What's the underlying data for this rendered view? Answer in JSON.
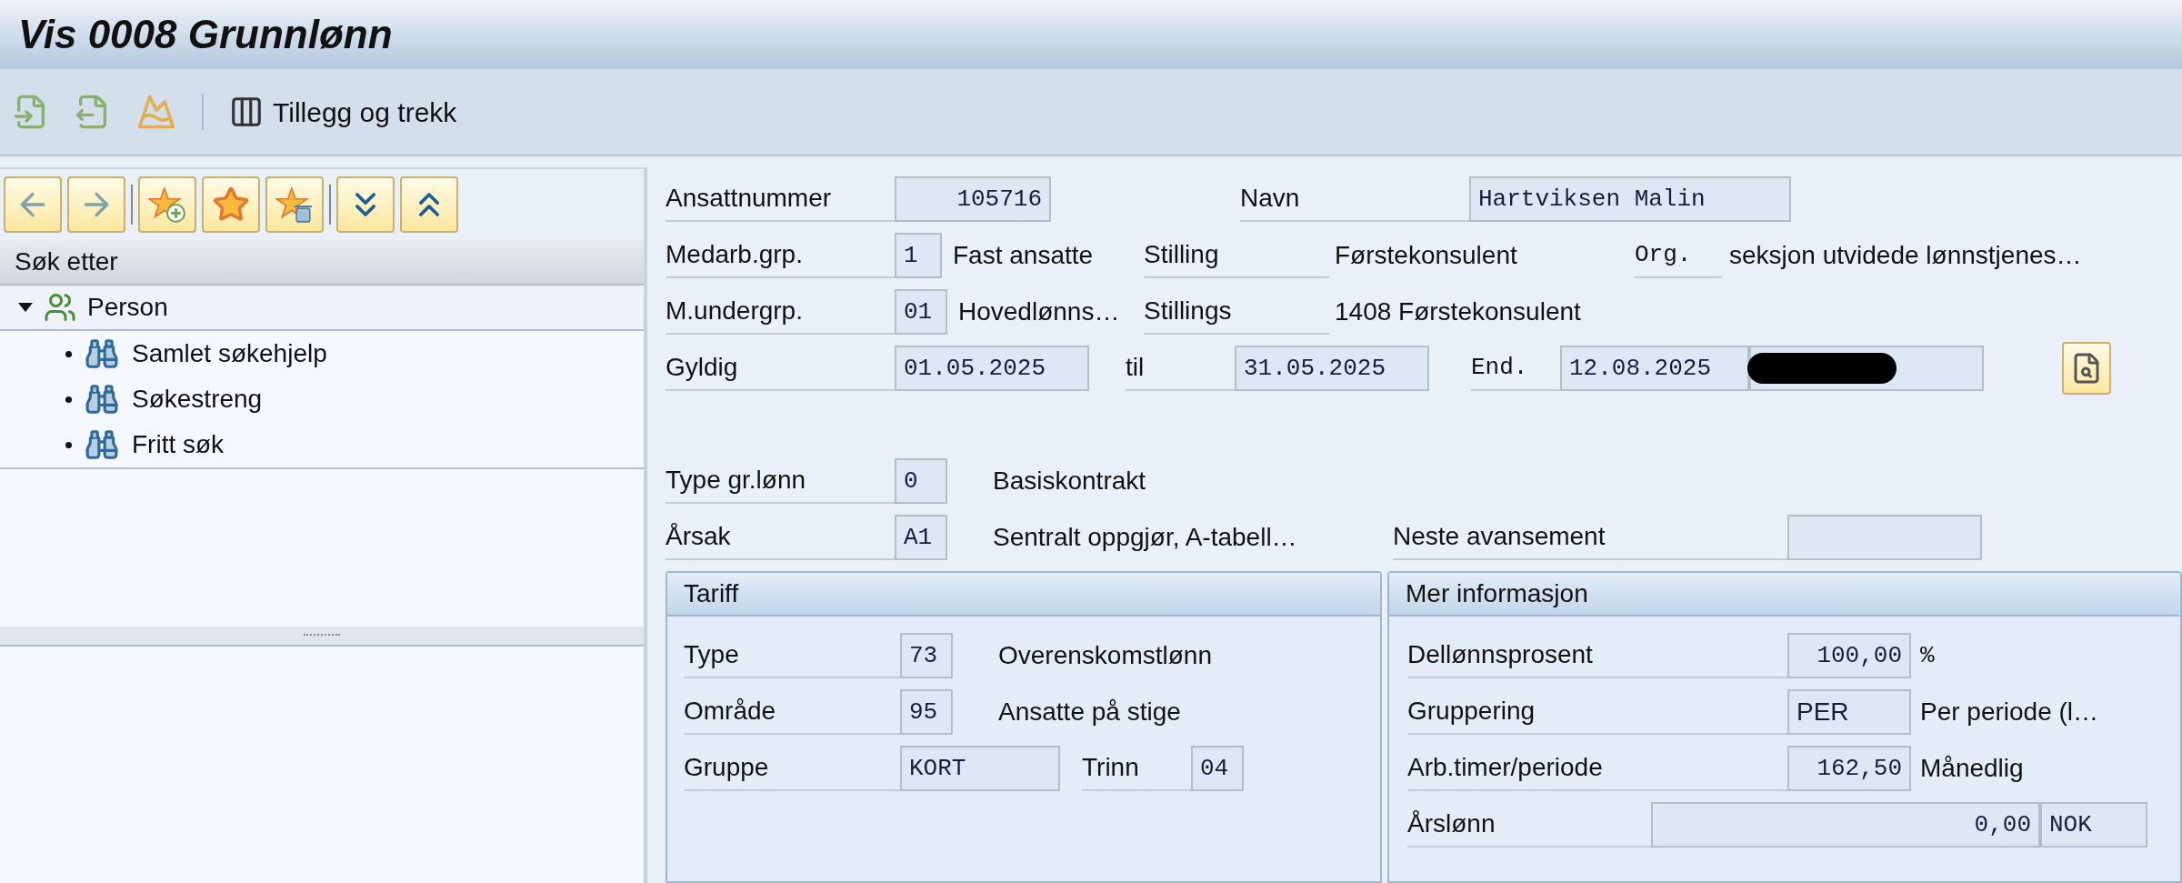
{
  "window": {
    "title": "Vis 0008 Grunnlønn"
  },
  "toolbar": {
    "button": "Tillegg og trekk"
  },
  "nav_panel": {
    "heading": "Søk etter",
    "tree": [
      {
        "label": "Person",
        "expanded": true,
        "children": [
          {
            "label": "Samlet søkehjelp"
          },
          {
            "label": "Søkestreng"
          },
          {
            "label": "Fritt søk"
          }
        ]
      }
    ]
  },
  "header": {
    "employee_number": {
      "label": "Ansattnummer",
      "value": "105716"
    },
    "name": {
      "label": "Navn",
      "value": "Hartviksen Malin"
    },
    "employee_group": {
      "label": "Medarb.grp.",
      "value": "1",
      "text": "Fast ansatte"
    },
    "position": {
      "label": "Stilling",
      "text": "Førstekonsulent"
    },
    "org": {
      "label": "Org.",
      "text": "seksjon utvidede lønnstjenes…"
    },
    "employee_subgroup": {
      "label": "M.undergrp.",
      "value": "01",
      "text": "Hovedlønns…"
    },
    "job": {
      "label": "Stillings",
      "text": "1408 Førstekonsulent"
    },
    "valid_from": {
      "label": "Gyldig",
      "value": "01.05.2025"
    },
    "valid_to": {
      "label": "til",
      "value": "31.05.2025"
    },
    "changed": {
      "label": "End.",
      "value": "12.08.2025"
    }
  },
  "basic_pay": {
    "pay_type": {
      "label": "Type gr.lønn",
      "value": "0",
      "text": "Basiskontrakt"
    },
    "reason": {
      "label": "Årsak",
      "value": "A1",
      "text": "Sentralt oppgjør, A-tabell…"
    },
    "next_promotion": {
      "label": "Neste avansement"
    }
  },
  "tariff": {
    "title": "Tariff",
    "type": {
      "label": "Type",
      "value": "73",
      "text": "Overenskomstlønn"
    },
    "area": {
      "label": "Område",
      "value": "95",
      "text": "Ansatte på stige"
    },
    "group": {
      "label": "Gruppe",
      "value": "KORT"
    },
    "step": {
      "label": "Trinn",
      "value": "04"
    }
  },
  "more_info": {
    "title": "Mer informasjon",
    "part_time": {
      "label": "Dellønnsprosent",
      "value": "100,00",
      "unit": "%"
    },
    "grouping": {
      "label": "Gruppering",
      "value": "PER",
      "text": "Per periode (l…"
    },
    "hours": {
      "label": "Arb.timer/periode",
      "value": "162,50",
      "text": "Månedlig"
    },
    "annual": {
      "label": "Årslønn",
      "value": "0,00",
      "currency": "NOK"
    }
  }
}
